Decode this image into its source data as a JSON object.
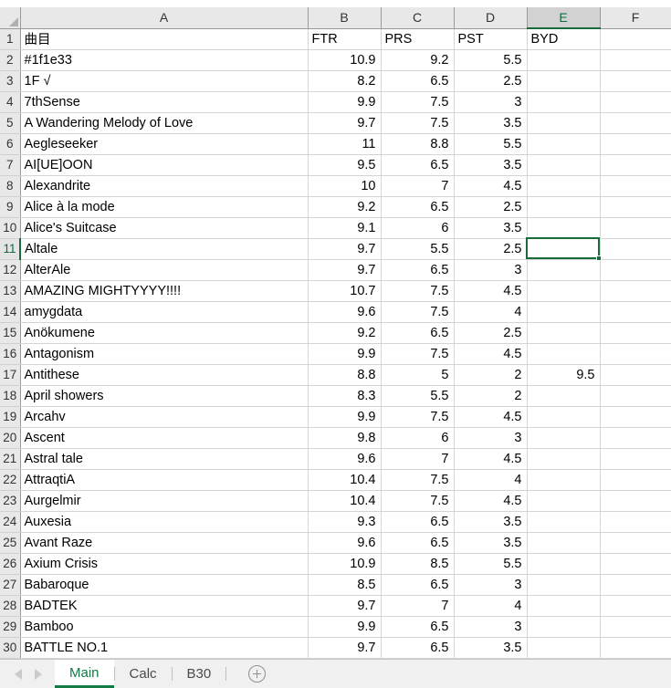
{
  "app": {
    "type": "spreadsheet",
    "active_cell": "E11",
    "active_column": "E",
    "active_row": 11,
    "accent_color": "#137a44",
    "header_bg": "#e8e8e8",
    "gridline_color": "#d4d4d4"
  },
  "grid": {
    "column_headers": [
      "A",
      "B",
      "C",
      "D",
      "E",
      "F"
    ],
    "corner_icon": "select-all-triangle-icon",
    "row_numbers": [
      1,
      2,
      3,
      4,
      5,
      6,
      7,
      8,
      9,
      10,
      11,
      12,
      13,
      14,
      15,
      16,
      17,
      18,
      19,
      20,
      21,
      22,
      23,
      24,
      25,
      26,
      27,
      28,
      29,
      30
    ],
    "rows": [
      {
        "n": 1,
        "a": "曲目",
        "b": "FTR",
        "c": "PRS",
        "d": "PST",
        "e": "BYD",
        "f": "",
        "type": "header"
      },
      {
        "n": 2,
        "a": "#1f1e33",
        "b": "10.9",
        "c": "9.2",
        "d": "5.5",
        "e": "",
        "f": ""
      },
      {
        "n": 3,
        "a": "1F √",
        "b": "8.2",
        "c": "6.5",
        "d": "2.5",
        "e": "",
        "f": ""
      },
      {
        "n": 4,
        "a": "7thSense",
        "b": "9.9",
        "c": "7.5",
        "d": "3",
        "e": "",
        "f": ""
      },
      {
        "n": 5,
        "a": "A Wandering Melody of Love",
        "b": "9.7",
        "c": "7.5",
        "d": "3.5",
        "e": "",
        "f": ""
      },
      {
        "n": 6,
        "a": "Aegleseeker",
        "b": "11",
        "c": "8.8",
        "d": "5.5",
        "e": "",
        "f": ""
      },
      {
        "n": 7,
        "a": "AI[UE]OON",
        "b": "9.5",
        "c": "6.5",
        "d": "3.5",
        "e": "",
        "f": ""
      },
      {
        "n": 8,
        "a": "Alexandrite",
        "b": "10",
        "c": "7",
        "d": "4.5",
        "e": "",
        "f": ""
      },
      {
        "n": 9,
        "a": "Alice à la mode",
        "b": "9.2",
        "c": "6.5",
        "d": "2.5",
        "e": "",
        "f": ""
      },
      {
        "n": 10,
        "a": "Alice's Suitcase",
        "b": "9.1",
        "c": "6",
        "d": "3.5",
        "e": "",
        "f": ""
      },
      {
        "n": 11,
        "a": "Altale",
        "b": "9.7",
        "c": "5.5",
        "d": "2.5",
        "e": "",
        "f": ""
      },
      {
        "n": 12,
        "a": "AlterAle",
        "b": "9.7",
        "c": "6.5",
        "d": "3",
        "e": "",
        "f": ""
      },
      {
        "n": 13,
        "a": "AMAZING MIGHTYYYY!!!!",
        "b": "10.7",
        "c": "7.5",
        "d": "4.5",
        "e": "",
        "f": ""
      },
      {
        "n": 14,
        "a": "amygdata",
        "b": "9.6",
        "c": "7.5",
        "d": "4",
        "e": "",
        "f": ""
      },
      {
        "n": 15,
        "a": "Anökumene",
        "b": "9.2",
        "c": "6.5",
        "d": "2.5",
        "e": "",
        "f": ""
      },
      {
        "n": 16,
        "a": "Antagonism",
        "b": "9.9",
        "c": "7.5",
        "d": "4.5",
        "e": "",
        "f": ""
      },
      {
        "n": 17,
        "a": "Antithese",
        "b": "8.8",
        "c": "5",
        "d": "2",
        "e": "9.5",
        "f": ""
      },
      {
        "n": 18,
        "a": "April showers",
        "b": "8.3",
        "c": "5.5",
        "d": "2",
        "e": "",
        "f": ""
      },
      {
        "n": 19,
        "a": "Arcahv",
        "b": "9.9",
        "c": "7.5",
        "d": "4.5",
        "e": "",
        "f": ""
      },
      {
        "n": 20,
        "a": "Ascent",
        "b": "9.8",
        "c": "6",
        "d": "3",
        "e": "",
        "f": ""
      },
      {
        "n": 21,
        "a": "Astral tale",
        "b": "9.6",
        "c": "7",
        "d": "4.5",
        "e": "",
        "f": ""
      },
      {
        "n": 22,
        "a": "AttraqtiA",
        "b": "10.4",
        "c": "7.5",
        "d": "4",
        "e": "",
        "f": ""
      },
      {
        "n": 23,
        "a": "Aurgelmir",
        "b": "10.4",
        "c": "7.5",
        "d": "4.5",
        "e": "",
        "f": ""
      },
      {
        "n": 24,
        "a": "Auxesia",
        "b": "9.3",
        "c": "6.5",
        "d": "3.5",
        "e": "",
        "f": ""
      },
      {
        "n": 25,
        "a": "Avant Raze",
        "b": "9.6",
        "c": "6.5",
        "d": "3.5",
        "e": "",
        "f": ""
      },
      {
        "n": 26,
        "a": "Axium Crisis",
        "b": "10.9",
        "c": "8.5",
        "d": "5.5",
        "e": "",
        "f": ""
      },
      {
        "n": 27,
        "a": "Babaroque",
        "b": "8.5",
        "c": "6.5",
        "d": "3",
        "e": "",
        "f": ""
      },
      {
        "n": 28,
        "a": "BADTEK",
        "b": "9.7",
        "c": "7",
        "d": "4",
        "e": "",
        "f": ""
      },
      {
        "n": 29,
        "a": "Bamboo",
        "b": "9.9",
        "c": "6.5",
        "d": "3",
        "e": "",
        "f": ""
      },
      {
        "n": 30,
        "a": "BATTLE NO.1",
        "b": "9.7",
        "c": "6.5",
        "d": "3.5",
        "e": "",
        "f": ""
      }
    ]
  },
  "sheet_tabs": {
    "prev_icon": "nav-left-arrow-icon",
    "next_icon": "nav-right-arrow-icon",
    "add_icon": "add-sheet-plus-icon",
    "items": [
      {
        "label": "Main",
        "active": true
      },
      {
        "label": "Calc",
        "active": false
      },
      {
        "label": "B30",
        "active": false
      }
    ]
  }
}
